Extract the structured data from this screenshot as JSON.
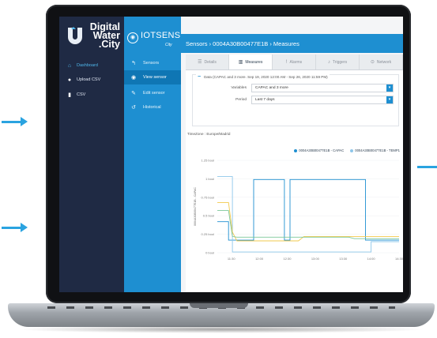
{
  "logo": {
    "line1": "Digital",
    "line2": "Water",
    "line3": ".City"
  },
  "nav": {
    "items": [
      {
        "label": "Dashboard",
        "icon": "home-icon"
      },
      {
        "label": "Upload CSV",
        "icon": "user-icon"
      },
      {
        "label": "CSV",
        "icon": "document-icon"
      }
    ]
  },
  "brand": {
    "name": "IOTSENS",
    "sub": "City"
  },
  "sidebar": {
    "items": [
      {
        "label": "Sensors",
        "icon": "back-arrow-icon"
      },
      {
        "label": "View sensor",
        "icon": "eye-icon"
      },
      {
        "label": "Edit sensor",
        "icon": "pencil-icon"
      },
      {
        "label": "Historical",
        "icon": "history-icon"
      }
    ]
  },
  "header": {
    "breadcrumb": "Sensors › 0004A30B00477E1B › Measures"
  },
  "tabs": [
    {
      "label": "Details",
      "icon": "list-icon"
    },
    {
      "label": "Measures",
      "icon": "bar-chart-icon"
    },
    {
      "label": "Alarms",
      "icon": "exclamation-icon"
    },
    {
      "label": "Triggers",
      "icon": "bell-icon"
    },
    {
      "label": "Network",
      "icon": "pin-icon"
    }
  ],
  "filter": {
    "summary": "Data (CAPAC and 3 more. Sep 19, 2020 12:00 AM - Sep 26, 2020 11:59 PM)",
    "variables_label": "Variables",
    "variables_value": "CAPAC and 3 more",
    "period_label": "Period",
    "period_value": "Last 7 days"
  },
  "timezone": "TimeZone : Europe/Madrid",
  "colors": {
    "nav": "#1f2a44",
    "sidebar": "#1e8fd1",
    "series1": "#1e8fd1",
    "series2": "#8ec7ea"
  },
  "chart_data": {
    "type": "line",
    "ylabel": "0004A30B00477E1B - CAPAC",
    "yticks": [
      "0 bool",
      "0.25 bool",
      "0.5 bool",
      "0.75 bool",
      "1 bool",
      "1.25 bool"
    ],
    "xticks": [
      "11:30",
      "12:00",
      "12:30",
      "13:00",
      "13:30",
      "14:00",
      "14:30"
    ],
    "ylim": [
      0,
      1.25
    ],
    "xlim": [
      11.25,
      14.5
    ],
    "series": [
      {
        "name": "0004A30B00477E1B - CAPAC",
        "color": "#1e8fd1",
        "x": [
          11.25,
          11.45,
          11.45,
          11.9,
          11.9,
          12.45,
          12.45,
          12.55,
          12.55,
          13.9,
          13.9,
          14.5
        ],
        "y": [
          0.42,
          0.42,
          0.17,
          0.17,
          0.99,
          0.99,
          0.17,
          0.17,
          0.99,
          0.99,
          0.17,
          0.17
        ]
      },
      {
        "name": "0004A30B00477E1B - TEMP1",
        "color": "#8ec7ea",
        "x": [
          11.25,
          11.52,
          11.52,
          14.0,
          14.0,
          14.5
        ],
        "y": [
          1.03,
          1.03,
          0.01,
          0.01,
          0.15,
          0.15
        ]
      },
      {
        "name": "",
        "color": "#f2c94c",
        "x": [
          11.25,
          11.45,
          11.52,
          11.6,
          12.7,
          12.8,
          14.5
        ],
        "y": [
          0.68,
          0.68,
          0.28,
          0.16,
          0.16,
          0.22,
          0.22
        ]
      },
      {
        "name": "",
        "color": "#7cc89a",
        "x": [
          11.25,
          11.45,
          11.52,
          11.6,
          13.6,
          13.7,
          14.5
        ],
        "y": [
          0.57,
          0.57,
          0.22,
          0.21,
          0.21,
          0.19,
          0.19
        ]
      }
    ]
  }
}
